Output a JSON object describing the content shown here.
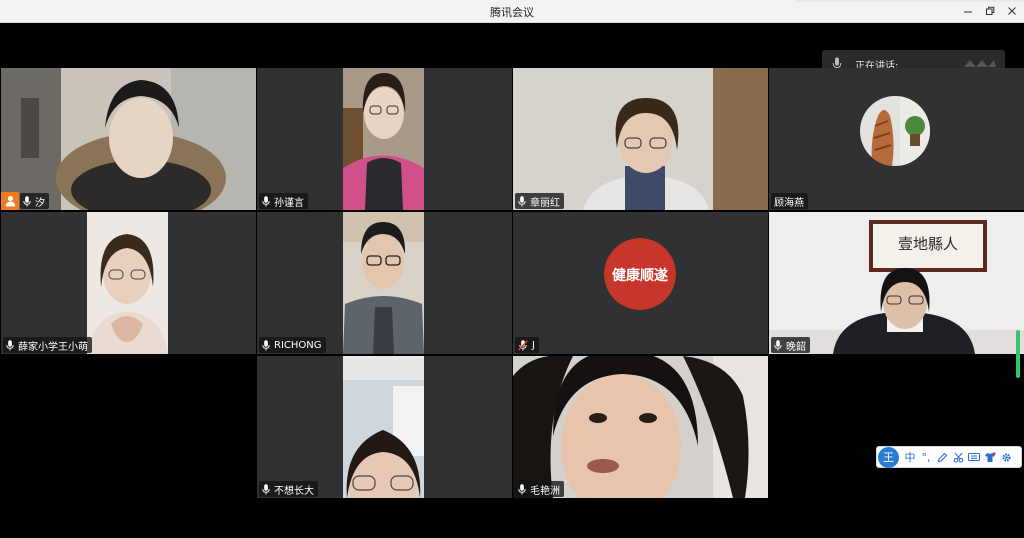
{
  "window": {
    "title": "腾讯会议"
  },
  "speaking": {
    "label": "正在讲话:"
  },
  "participants": [
    {
      "name": "汐",
      "host": true
    },
    {
      "name": "孙谨言"
    },
    {
      "name": "章丽红"
    },
    {
      "name": "顾海燕"
    },
    {
      "name": "薛家小学王小萌"
    },
    {
      "name": "RICHONG"
    },
    {
      "name": "J",
      "muted": true
    },
    {
      "name": "晚韶"
    },
    {
      "name": "不想长大"
    },
    {
      "name": "毛艳洲"
    }
  ],
  "avatar_logo_text": "健康顺遂",
  "wall_calligraphy": "壹地縣人",
  "ime_toolbar": {
    "logo": "王",
    "mode": "中",
    "punct": "°,"
  },
  "colors": {
    "host_badge": "#f07a1c",
    "tile_bg": "#2f3133",
    "speaking_bar": "#37c46b",
    "logo_red": "#c8352a"
  }
}
